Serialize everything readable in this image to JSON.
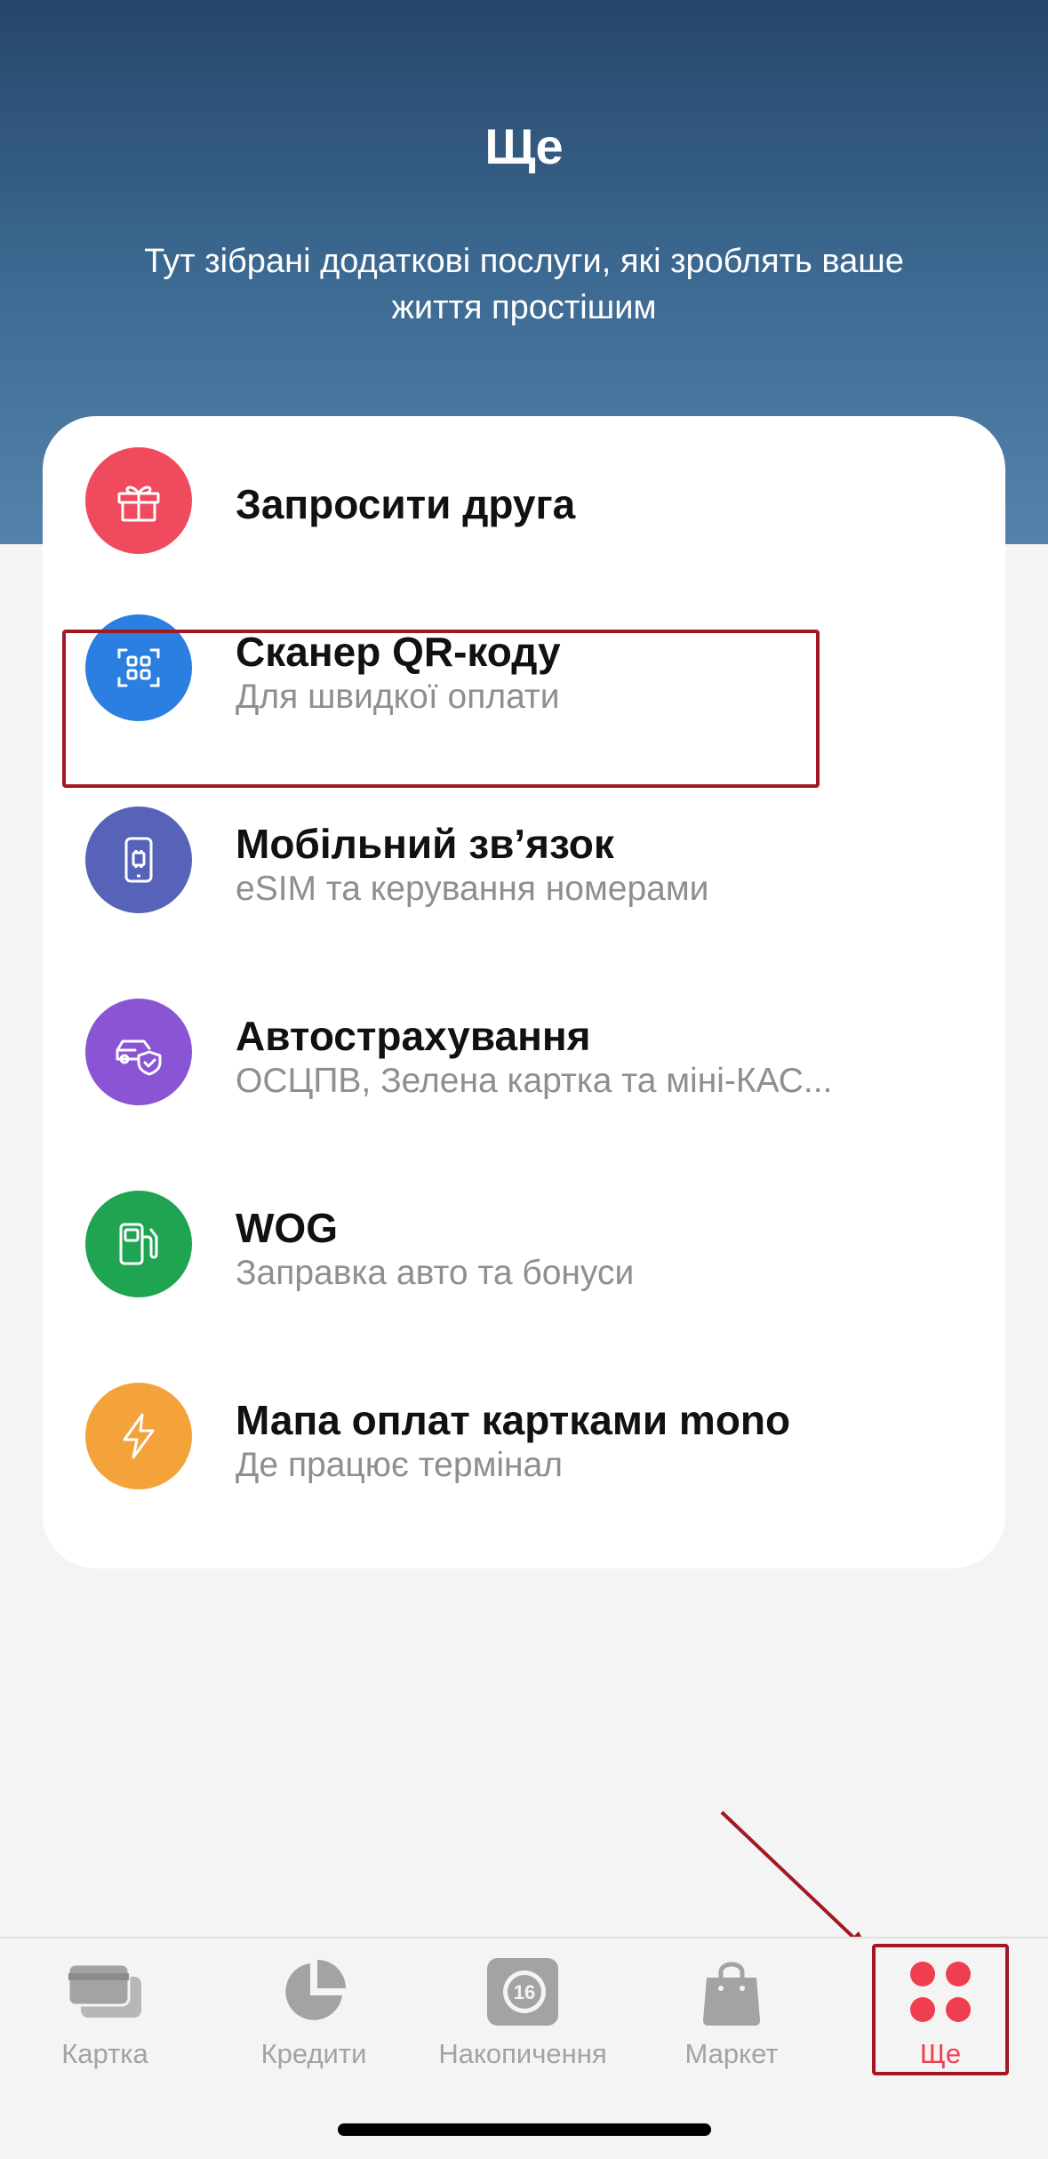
{
  "header": {
    "title": "Ще",
    "subtitle": "Тут зібрані додаткові послуги, які зроблять ваше життя простішим"
  },
  "services": [
    {
      "title": "Запросити друга",
      "subtitle": "",
      "icon": "gift-icon",
      "color": "#f04a5e"
    },
    {
      "title": "Сканер QR-коду",
      "subtitle": "Для швидкої оплати",
      "icon": "qr-scan-icon",
      "color": "#2a7fe0"
    },
    {
      "title": "Мобільний зв’язок",
      "subtitle": "eSIM та керування номерами",
      "icon": "phone-sim-icon",
      "color": "#5663b8"
    },
    {
      "title": "Автострахування",
      "subtitle": "ОСЦПВ, Зелена картка та міні-КАС...",
      "icon": "car-shield-icon",
      "color": "#8a55d4"
    },
    {
      "title": "WOG",
      "subtitle": "Заправка авто та бонуси",
      "icon": "fuel-pump-icon",
      "color": "#1fa552"
    },
    {
      "title": "Мапа оплат картками mono",
      "subtitle": "Де працює термінал",
      "icon": "lightning-icon",
      "color": "#f4a33b"
    }
  ],
  "tabbar": {
    "tabs": [
      {
        "label": "Картка",
        "icon": "cards-icon",
        "active": false
      },
      {
        "label": "Кредити",
        "icon": "pie-chart-icon",
        "active": false
      },
      {
        "label": "Накопичення",
        "icon": "savings-icon",
        "badge": "16",
        "active": false
      },
      {
        "label": "Маркет",
        "icon": "shopping-bag-icon",
        "active": false
      },
      {
        "label": "Ще",
        "icon": "four-dots-icon",
        "active": true
      }
    ],
    "active_color": "#ee3e4f",
    "inactive_color": "#a3a3a3"
  }
}
